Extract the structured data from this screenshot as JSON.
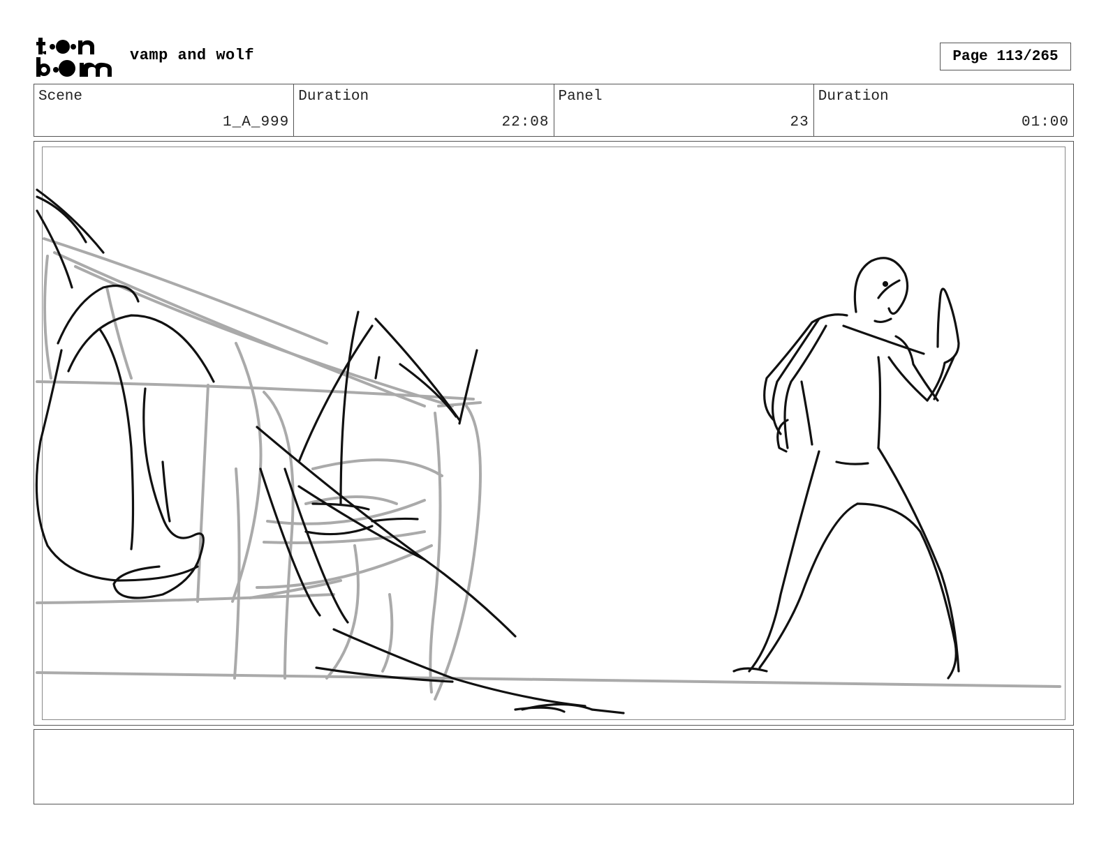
{
  "header": {
    "logo_text": "toon boom",
    "project_title": "vamp and wolf",
    "page_label": "Page 113/265"
  },
  "info": {
    "scene_label": "Scene",
    "scene_value": "1_A_999",
    "scene_duration_label": "Duration",
    "scene_duration_value": "22:08",
    "panel_label": "Panel",
    "panel_value": "23",
    "panel_duration_label": "Duration",
    "panel_duration_value": "01:00"
  },
  "notes": {
    "text": ""
  },
  "colors": {
    "border": "#555555",
    "sketch_dark": "#111111",
    "sketch_light": "#aaaaaa"
  }
}
